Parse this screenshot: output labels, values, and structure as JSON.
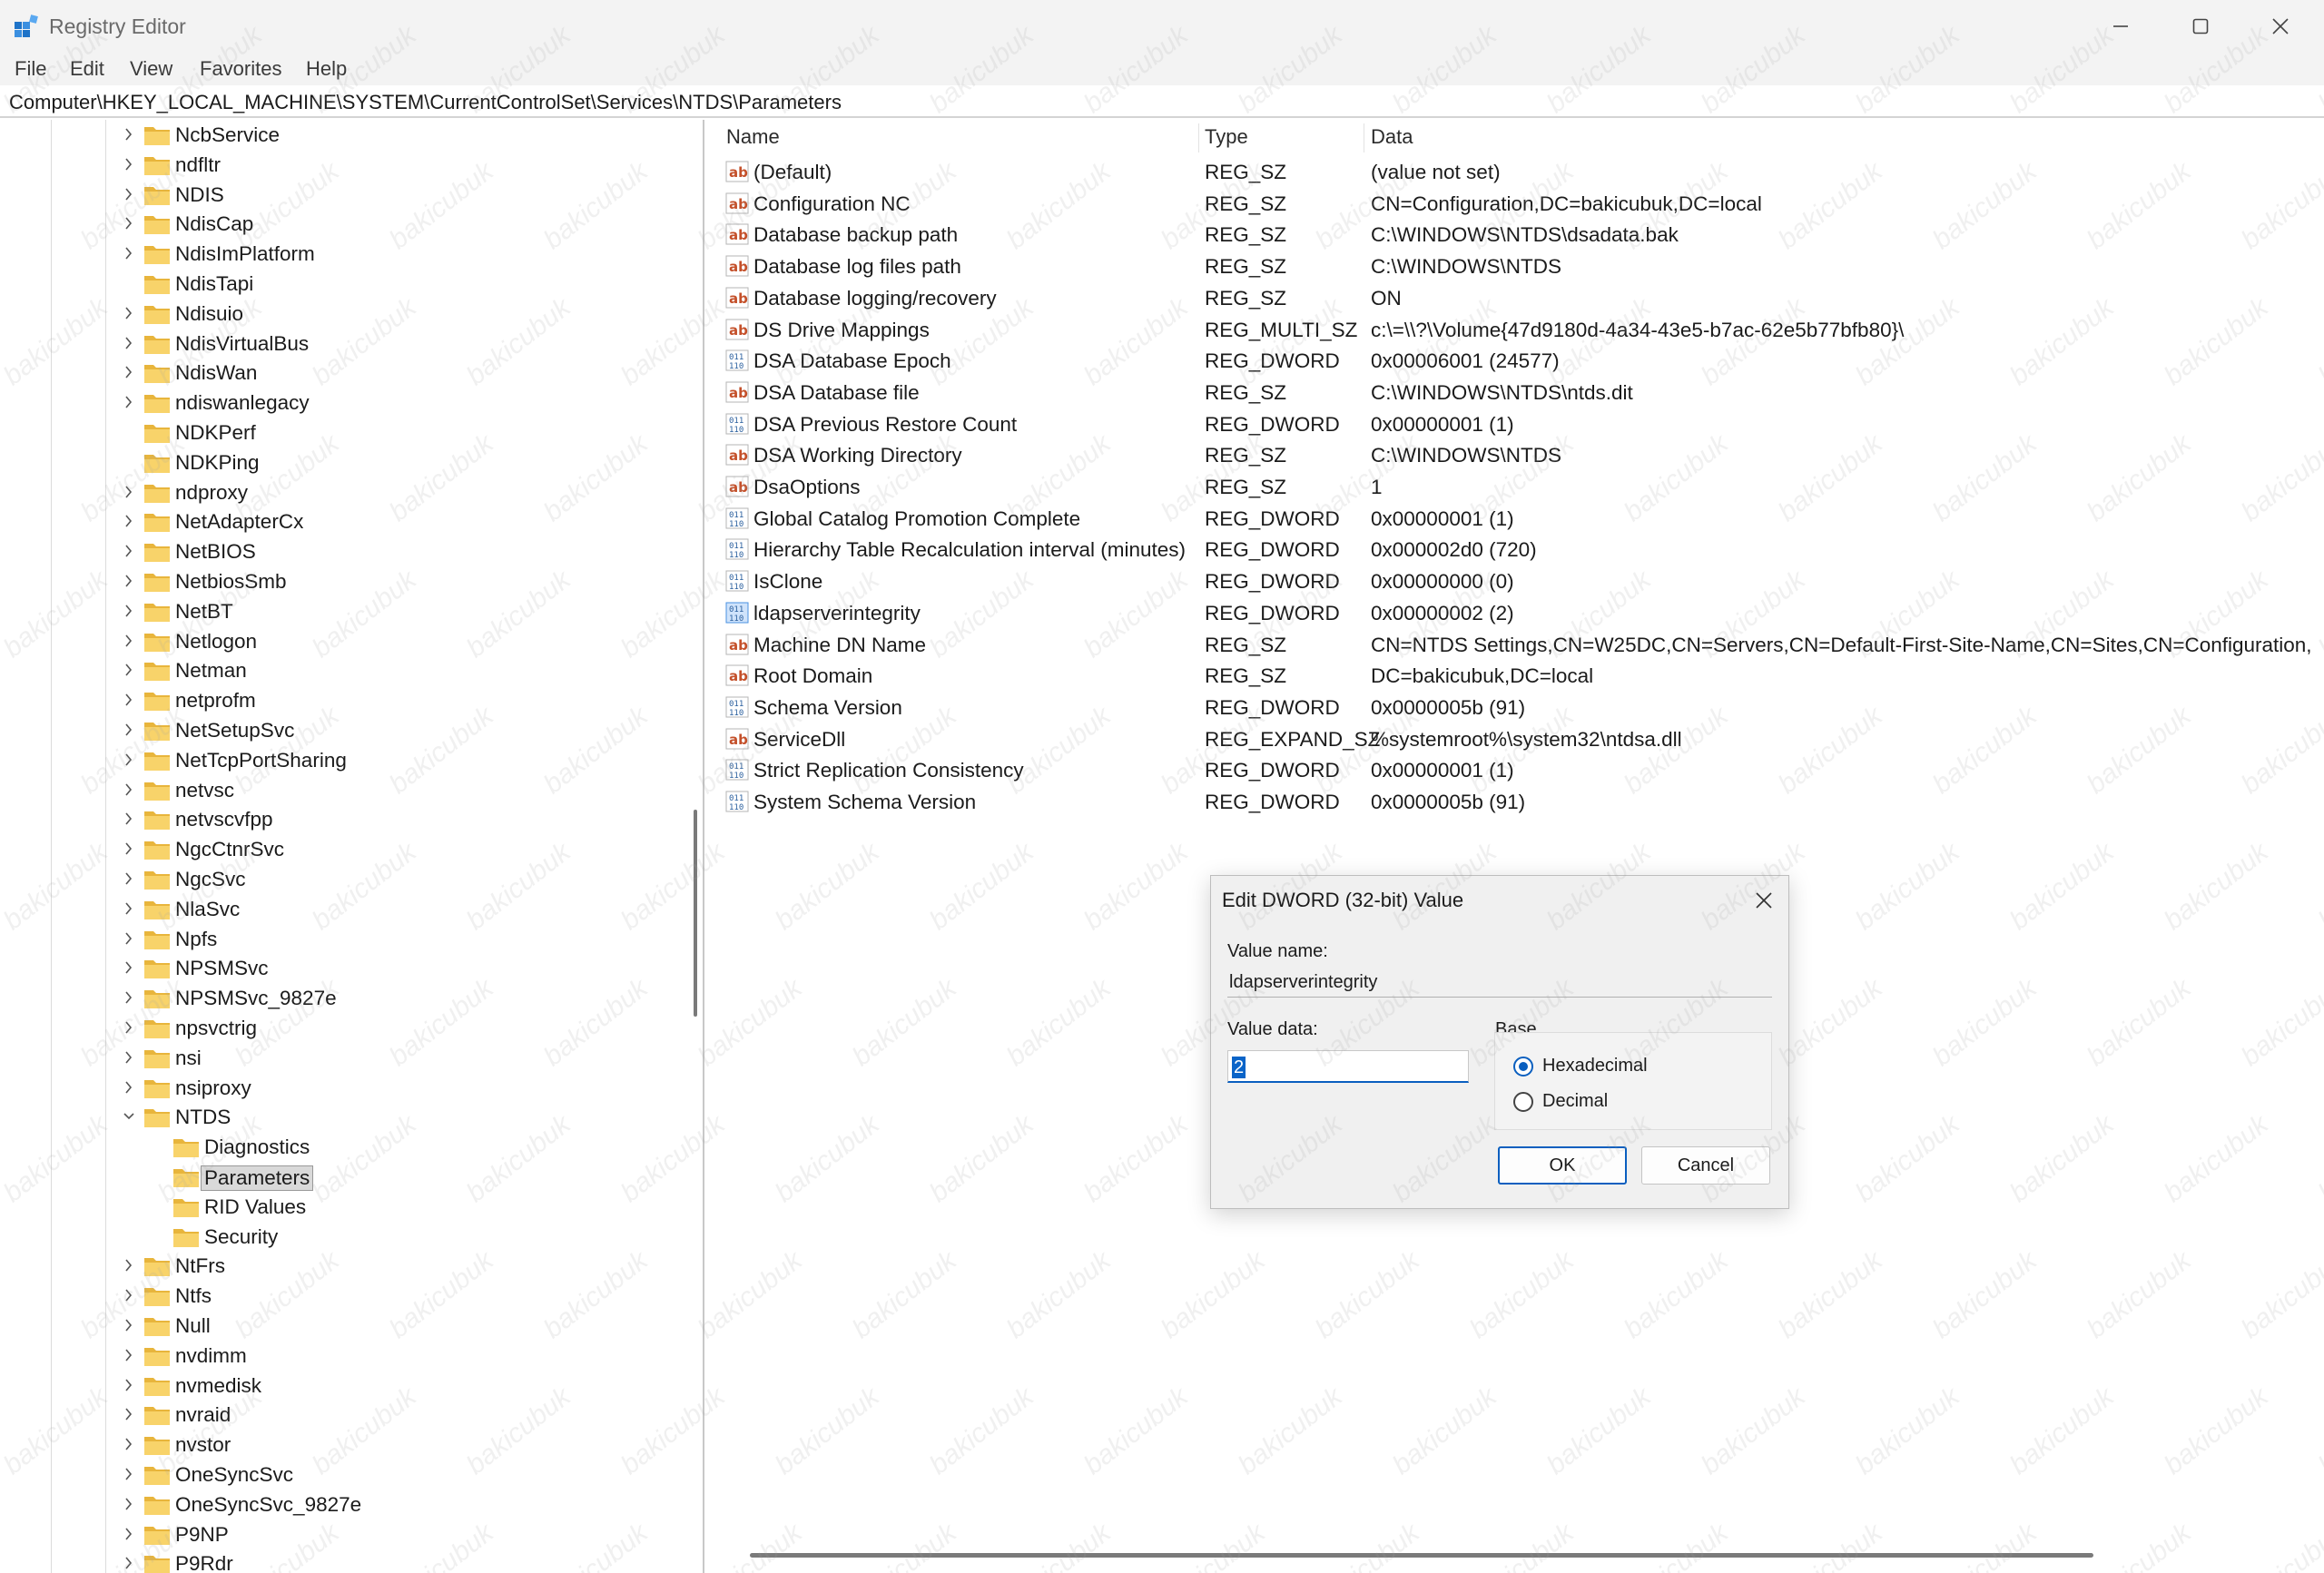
{
  "window": {
    "title": "Registry Editor",
    "accent_color": "#0a5fbf"
  },
  "menu": [
    "File",
    "Edit",
    "View",
    "Favorites",
    "Help"
  ],
  "address": "Computer\\HKEY_LOCAL_MACHINE\\SYSTEM\\CurrentControlSet\\Services\\NTDS\\Parameters",
  "tree": {
    "items": [
      {
        "label": "NcbService",
        "level": 1,
        "expander": "collapsed"
      },
      {
        "label": "ndfltr",
        "level": 1,
        "expander": "collapsed"
      },
      {
        "label": "NDIS",
        "level": 1,
        "expander": "collapsed"
      },
      {
        "label": "NdisCap",
        "level": 1,
        "expander": "collapsed"
      },
      {
        "label": "NdisImPlatform",
        "level": 1,
        "expander": "collapsed"
      },
      {
        "label": "NdisTapi",
        "level": 1,
        "expander": "none"
      },
      {
        "label": "Ndisuio",
        "level": 1,
        "expander": "collapsed"
      },
      {
        "label": "NdisVirtualBus",
        "level": 1,
        "expander": "collapsed"
      },
      {
        "label": "NdisWan",
        "level": 1,
        "expander": "collapsed"
      },
      {
        "label": "ndiswanlegacy",
        "level": 1,
        "expander": "collapsed"
      },
      {
        "label": "NDKPerf",
        "level": 1,
        "expander": "none"
      },
      {
        "label": "NDKPing",
        "level": 1,
        "expander": "none"
      },
      {
        "label": "ndproxy",
        "level": 1,
        "expander": "collapsed"
      },
      {
        "label": "NetAdapterCx",
        "level": 1,
        "expander": "collapsed"
      },
      {
        "label": "NetBIOS",
        "level": 1,
        "expander": "collapsed"
      },
      {
        "label": "NetbiosSmb",
        "level": 1,
        "expander": "collapsed"
      },
      {
        "label": "NetBT",
        "level": 1,
        "expander": "collapsed"
      },
      {
        "label": "Netlogon",
        "level": 1,
        "expander": "collapsed"
      },
      {
        "label": "Netman",
        "level": 1,
        "expander": "collapsed"
      },
      {
        "label": "netprofm",
        "level": 1,
        "expander": "collapsed"
      },
      {
        "label": "NetSetupSvc",
        "level": 1,
        "expander": "collapsed"
      },
      {
        "label": "NetTcpPortSharing",
        "level": 1,
        "expander": "collapsed"
      },
      {
        "label": "netvsc",
        "level": 1,
        "expander": "collapsed"
      },
      {
        "label": "netvscvfpp",
        "level": 1,
        "expander": "collapsed"
      },
      {
        "label": "NgcCtnrSvc",
        "level": 1,
        "expander": "collapsed"
      },
      {
        "label": "NgcSvc",
        "level": 1,
        "expander": "collapsed"
      },
      {
        "label": "NlaSvc",
        "level": 1,
        "expander": "collapsed"
      },
      {
        "label": "Npfs",
        "level": 1,
        "expander": "collapsed"
      },
      {
        "label": "NPSMSvc",
        "level": 1,
        "expander": "collapsed"
      },
      {
        "label": "NPSMSvc_9827e",
        "level": 1,
        "expander": "collapsed"
      },
      {
        "label": "npsvctrig",
        "level": 1,
        "expander": "collapsed"
      },
      {
        "label": "nsi",
        "level": 1,
        "expander": "collapsed"
      },
      {
        "label": "nsiproxy",
        "level": 1,
        "expander": "collapsed"
      },
      {
        "label": "NTDS",
        "level": 1,
        "expander": "expanded"
      },
      {
        "label": "Diagnostics",
        "level": 2,
        "expander": "none"
      },
      {
        "label": "Parameters",
        "level": 2,
        "expander": "none",
        "selected": true
      },
      {
        "label": "RID Values",
        "level": 2,
        "expander": "none"
      },
      {
        "label": "Security",
        "level": 2,
        "expander": "none"
      },
      {
        "label": "NtFrs",
        "level": 1,
        "expander": "collapsed"
      },
      {
        "label": "Ntfs",
        "level": 1,
        "expander": "collapsed"
      },
      {
        "label": "Null",
        "level": 1,
        "expander": "collapsed"
      },
      {
        "label": "nvdimm",
        "level": 1,
        "expander": "collapsed"
      },
      {
        "label": "nvmedisk",
        "level": 1,
        "expander": "collapsed"
      },
      {
        "label": "nvraid",
        "level": 1,
        "expander": "collapsed"
      },
      {
        "label": "nvstor",
        "level": 1,
        "expander": "collapsed"
      },
      {
        "label": "OneSyncSvc",
        "level": 1,
        "expander": "collapsed"
      },
      {
        "label": "OneSyncSvc_9827e",
        "level": 1,
        "expander": "collapsed"
      },
      {
        "label": "P9NP",
        "level": 1,
        "expander": "collapsed"
      },
      {
        "label": "P9Rdr",
        "level": 1,
        "expander": "collapsed"
      }
    ]
  },
  "list": {
    "columns": [
      "Name",
      "Type",
      "Data"
    ],
    "rows": [
      {
        "icon": "string-value-icon",
        "name": "(Default)",
        "type": "REG_SZ",
        "data": "(value not set)"
      },
      {
        "icon": "string-value-icon",
        "name": "Configuration NC",
        "type": "REG_SZ",
        "data": "CN=Configuration,DC=bakicubuk,DC=local"
      },
      {
        "icon": "string-value-icon",
        "name": "Database backup path",
        "type": "REG_SZ",
        "data": "C:\\WINDOWS\\NTDS\\dsadata.bak"
      },
      {
        "icon": "string-value-icon",
        "name": "Database log files path",
        "type": "REG_SZ",
        "data": "C:\\WINDOWS\\NTDS"
      },
      {
        "icon": "string-value-icon",
        "name": "Database logging/recovery",
        "type": "REG_SZ",
        "data": "ON"
      },
      {
        "icon": "string-value-icon",
        "name": "DS Drive Mappings",
        "type": "REG_MULTI_SZ",
        "data": "c:\\=\\\\?\\Volume{47d9180d-4a34-43e5-b7ac-62e5b77bfb80}\\"
      },
      {
        "icon": "binary-value-icon",
        "name": "DSA Database Epoch",
        "type": "REG_DWORD",
        "data": "0x00006001 (24577)"
      },
      {
        "icon": "string-value-icon",
        "name": "DSA Database file",
        "type": "REG_SZ",
        "data": "C:\\WINDOWS\\NTDS\\ntds.dit"
      },
      {
        "icon": "binary-value-icon",
        "name": "DSA Previous Restore Count",
        "type": "REG_DWORD",
        "data": "0x00000001 (1)"
      },
      {
        "icon": "string-value-icon",
        "name": "DSA Working Directory",
        "type": "REG_SZ",
        "data": "C:\\WINDOWS\\NTDS"
      },
      {
        "icon": "string-value-icon",
        "name": "DsaOptions",
        "type": "REG_SZ",
        "data": "1"
      },
      {
        "icon": "binary-value-icon",
        "name": "Global Catalog Promotion Complete",
        "type": "REG_DWORD",
        "data": "0x00000001 (1)"
      },
      {
        "icon": "binary-value-icon",
        "name": "Hierarchy Table Recalculation interval (minutes)",
        "type": "REG_DWORD",
        "data": "0x000002d0 (720)"
      },
      {
        "icon": "binary-value-icon",
        "name": "IsClone",
        "type": "REG_DWORD",
        "data": "0x00000000 (0)"
      },
      {
        "icon": "binary-value-icon",
        "name": "ldapserverintegrity",
        "type": "REG_DWORD",
        "data": "0x00000002 (2)",
        "selected": true
      },
      {
        "icon": "string-value-icon",
        "name": "Machine DN Name",
        "type": "REG_SZ",
        "data": "CN=NTDS Settings,CN=W25DC,CN=Servers,CN=Default-First-Site-Name,CN=Sites,CN=Configuration,"
      },
      {
        "icon": "string-value-icon",
        "name": "Root Domain",
        "type": "REG_SZ",
        "data": "DC=bakicubuk,DC=local"
      },
      {
        "icon": "binary-value-icon",
        "name": "Schema Version",
        "type": "REG_DWORD",
        "data": "0x0000005b (91)"
      },
      {
        "icon": "string-value-icon",
        "name": "ServiceDll",
        "type": "REG_EXPAND_SZ",
        "data": "%systemroot%\\system32\\ntdsa.dll"
      },
      {
        "icon": "binary-value-icon",
        "name": "Strict Replication Consistency",
        "type": "REG_DWORD",
        "data": "0x00000001 (1)"
      },
      {
        "icon": "binary-value-icon",
        "name": "System Schema Version",
        "type": "REG_DWORD",
        "data": "0x0000005b (91)"
      }
    ]
  },
  "dialog": {
    "title": "Edit DWORD (32-bit) Value",
    "value_name_label": "Value name:",
    "value_name": "ldapserverintegrity",
    "value_data_label": "Value data:",
    "value_data": "2",
    "base_label": "Base",
    "base_options": [
      {
        "label": "Hexadecimal",
        "checked": true
      },
      {
        "label": "Decimal",
        "checked": false
      }
    ],
    "ok_label": "OK",
    "cancel_label": "Cancel"
  },
  "watermark": "bakicubuk"
}
